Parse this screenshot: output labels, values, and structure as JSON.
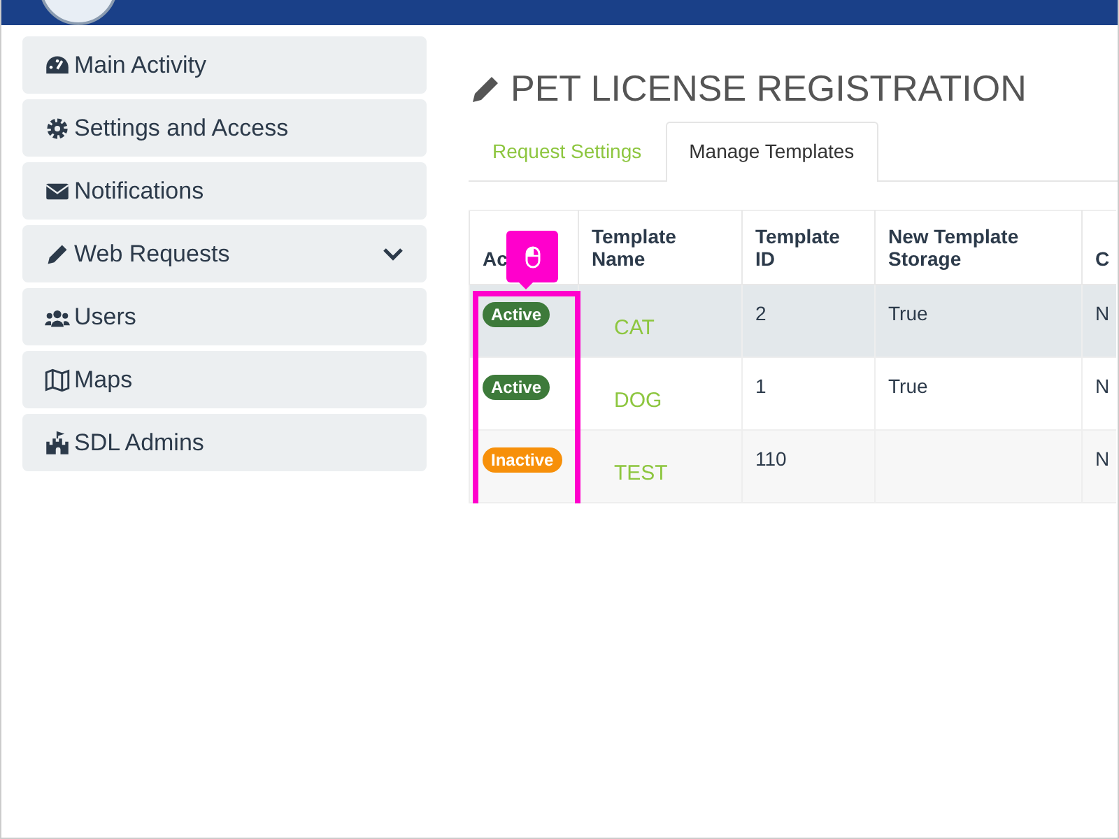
{
  "sidebar": {
    "items": [
      {
        "label": "Main Activity",
        "kind": "gauge"
      },
      {
        "label": "Settings and Access",
        "kind": "gear"
      },
      {
        "label": "Notifications",
        "kind": "envelope"
      },
      {
        "label": "Web Requests",
        "kind": "pencil",
        "expandable": true
      },
      {
        "label": "Users",
        "kind": "users"
      },
      {
        "label": "Maps",
        "kind": "map"
      },
      {
        "label": "SDL Admins",
        "kind": "castle"
      }
    ]
  },
  "page": {
    "title": "PET LICENSE REGISTRATION"
  },
  "tabs": [
    {
      "label": "Request Settings",
      "selected": false
    },
    {
      "label": "Manage Templates",
      "selected": true
    }
  ],
  "table": {
    "columns": [
      "Ac",
      "Template Name",
      "Template ID",
      "New Template Storage",
      "C"
    ],
    "rows": [
      {
        "status": "Active",
        "kind": "active",
        "name": "CAT",
        "id": "2",
        "storage": "True",
        "column_5": "N",
        "highlighted": true
      },
      {
        "status": "Active",
        "kind": "active",
        "name": "DOG",
        "id": "1",
        "storage": "True",
        "column_5": "N",
        "highlighted": false
      },
      {
        "status": "Inactive",
        "kind": "inactive",
        "name": "TEST",
        "id": "110",
        "column_5": "N",
        "highlighted": false
      }
    ]
  }
}
